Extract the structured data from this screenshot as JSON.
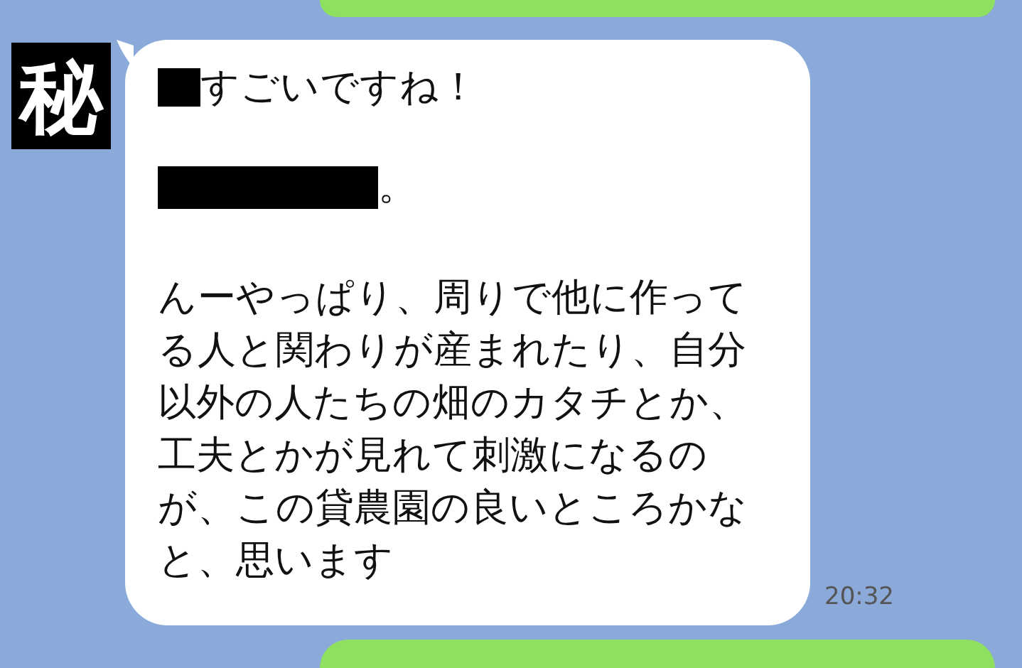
{
  "avatar": {
    "label": "秘"
  },
  "message": {
    "greeting": "すごいですね！",
    "second_line_end": "。",
    "paragraph_lines": [
      "んーやっぱり、周りで他に作って",
      "る人と関わりが産まれたり、自分",
      "以外の人たちの畑のカタチとか、",
      "工夫とかが見れて刺激になるの",
      "が、この貸農園の良いところかな",
      "と、思います"
    ],
    "time": "20:32"
  }
}
